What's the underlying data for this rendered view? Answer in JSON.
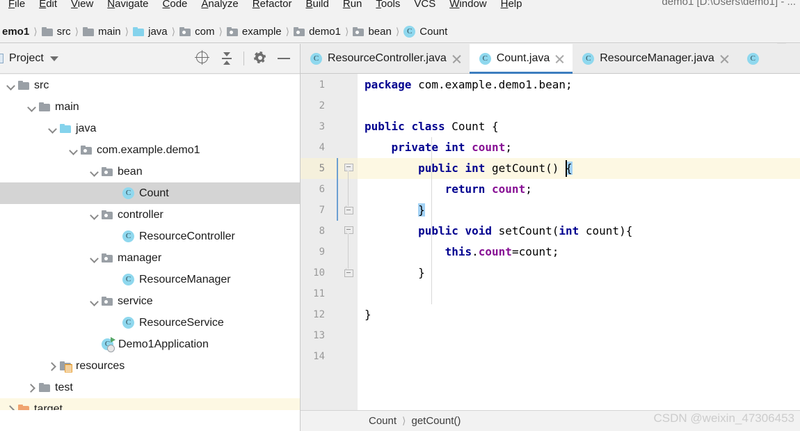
{
  "window": {
    "title": "demo1 [D:\\Users\\demo1] - ..."
  },
  "menubar": {
    "items": [
      {
        "pre": "F",
        "rest": "ile"
      },
      {
        "pre": "E",
        "rest": "dit"
      },
      {
        "pre": "V",
        "rest": "iew"
      },
      {
        "pre": "N",
        "rest": "avigate"
      },
      {
        "pre": "C",
        "rest": "ode"
      },
      {
        "pre": "A",
        "rest": "nalyze"
      },
      {
        "pre": "R",
        "rest": "efactor"
      },
      {
        "pre": "B",
        "rest": "uild"
      },
      {
        "pre": "R",
        "rest": "un"
      },
      {
        "pre": "T",
        "rest": "ools"
      },
      {
        "pre": "S",
        "rest": "VCS"
      },
      {
        "pre": "W",
        "rest": "indow"
      },
      {
        "pre": "H",
        "rest": "elp"
      }
    ]
  },
  "navbar": {
    "crumbs": [
      {
        "label": "emo1",
        "icon": "none"
      },
      {
        "label": "src",
        "icon": "folder-gray"
      },
      {
        "label": "main",
        "icon": "folder-gray"
      },
      {
        "label": "java",
        "icon": "folder-blue"
      },
      {
        "label": "com",
        "icon": "folder-package"
      },
      {
        "label": "example",
        "icon": "folder-package"
      },
      {
        "label": "demo1",
        "icon": "folder-package"
      },
      {
        "label": "bean",
        "icon": "folder-package"
      },
      {
        "label": "Count",
        "icon": "class"
      }
    ]
  },
  "project_panel": {
    "title": "Project",
    "actions": [
      "locate-icon",
      "collapse-all-icon",
      "gear-icon",
      "minimize-icon"
    ],
    "tree": [
      {
        "label": "src",
        "depth": 0,
        "twisty": "open",
        "icon": "folder-gray",
        "state": "normal"
      },
      {
        "label": "main",
        "depth": 1,
        "twisty": "open",
        "icon": "folder-gray",
        "state": "normal"
      },
      {
        "label": "java",
        "depth": 2,
        "twisty": "open",
        "icon": "folder-blue",
        "state": "normal"
      },
      {
        "label": "com.example.demo1",
        "depth": 3,
        "twisty": "open",
        "icon": "folder-package",
        "state": "normal"
      },
      {
        "label": "bean",
        "depth": 4,
        "twisty": "open",
        "icon": "folder-package",
        "state": "normal"
      },
      {
        "label": "Count",
        "depth": 5,
        "twisty": "none",
        "icon": "class",
        "state": "selected"
      },
      {
        "label": "controller",
        "depth": 4,
        "twisty": "open",
        "icon": "folder-package",
        "state": "normal"
      },
      {
        "label": "ResourceController",
        "depth": 5,
        "twisty": "none",
        "icon": "class",
        "state": "normal"
      },
      {
        "label": "manager",
        "depth": 4,
        "twisty": "open",
        "icon": "folder-package",
        "state": "normal"
      },
      {
        "label": "ResourceManager",
        "depth": 5,
        "twisty": "none",
        "icon": "class",
        "state": "normal"
      },
      {
        "label": "service",
        "depth": 4,
        "twisty": "open",
        "icon": "folder-package",
        "state": "normal"
      },
      {
        "label": "ResourceService",
        "depth": 5,
        "twisty": "none",
        "icon": "class",
        "state": "normal"
      },
      {
        "label": "Demo1Application",
        "depth": 4,
        "twisty": "none",
        "icon": "class-run",
        "state": "normal"
      },
      {
        "label": "resources",
        "depth": 2,
        "twisty": "closed",
        "icon": "folder-res",
        "state": "normal"
      },
      {
        "label": "test",
        "depth": 1,
        "twisty": "closed",
        "icon": "folder-gray",
        "state": "normal"
      },
      {
        "label": "target",
        "depth": 0,
        "twisty": "closed",
        "icon": "folder-orange",
        "state": "highlight"
      }
    ]
  },
  "editor": {
    "tabs": [
      {
        "label": "ResourceController.java",
        "icon": "class",
        "active": false,
        "close": true
      },
      {
        "label": "Count.java",
        "icon": "class",
        "active": true,
        "close": true
      },
      {
        "label": "ResourceManager.java",
        "icon": "class",
        "active": false,
        "close": true
      }
    ],
    "active_tab": "Count.java",
    "line_numbers": [
      "1",
      "2",
      "3",
      "4",
      "5",
      "6",
      "7",
      "8",
      "9",
      "10",
      "11",
      "12",
      "13",
      "14"
    ],
    "current_line": 5,
    "caret_line": 5,
    "lines": [
      "package com.example.demo1.bean;",
      "",
      "public class Count {",
      "    private int count;",
      "        public int getCount() {",
      "            return count;",
      "        }",
      "        public void setCount(int count){",
      "            this.count=count;",
      "        }",
      "",
      "}",
      "",
      ""
    ],
    "breadcrumb": [
      "Count",
      "getCount()"
    ],
    "accent_color": "#3d7ebf",
    "keyword_color": "#00008f",
    "field_color": "#871094",
    "current_line_bg": "#fdf8e3",
    "brace_match_bg": "#a3d2f5"
  },
  "watermark": {
    "text": "CSDN @weixin_47306453"
  }
}
